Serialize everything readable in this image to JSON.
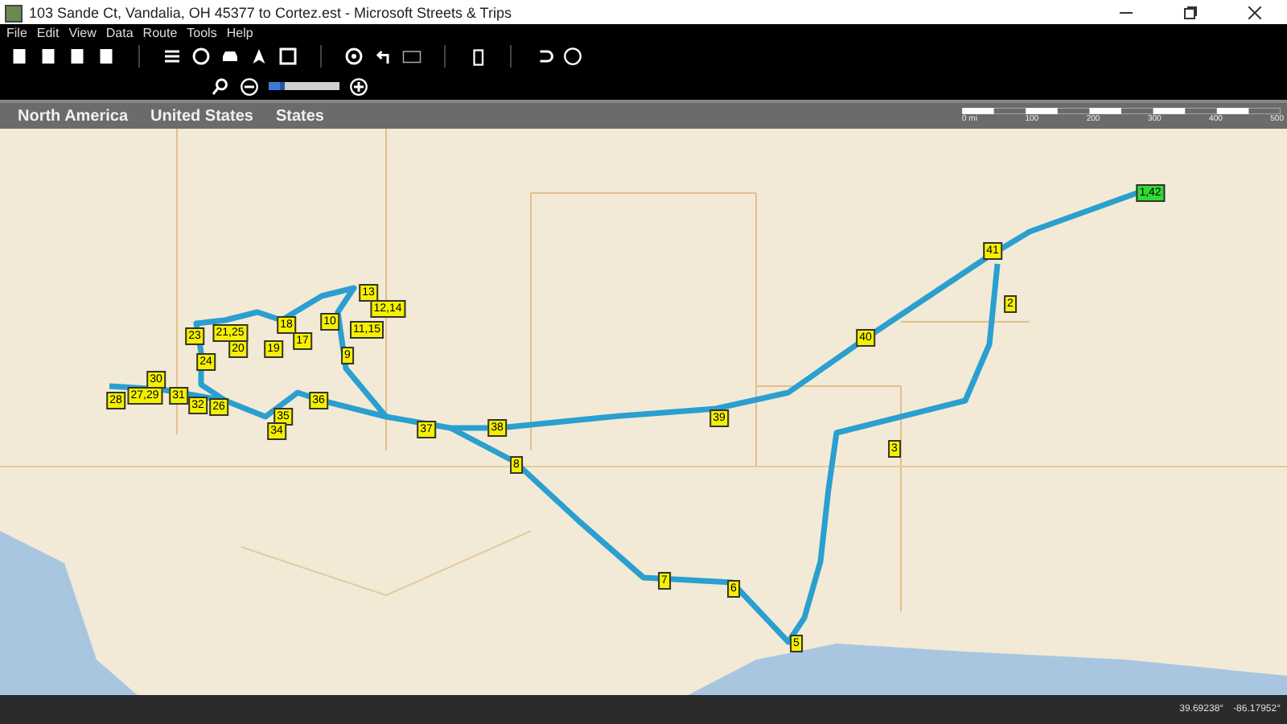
{
  "window": {
    "title": "103 Sande Ct, Vandalia, OH 45377 to Cortez.est - Microsoft Streets & Trips"
  },
  "menu": [
    "File",
    "Edit",
    "View",
    "Data",
    "Route",
    "Tools",
    "Help"
  ],
  "zoom_slider": {
    "level": 0.22
  },
  "breadcrumbs": [
    "North America",
    "United States",
    "States"
  ],
  "scale_bar": [
    "0 mi",
    "100",
    "200",
    "300",
    "400",
    "500"
  ],
  "stops": [
    {
      "label": "1,42",
      "kind": "start"
    },
    {
      "label": "41",
      "kind": "stop"
    },
    {
      "label": "13",
      "kind": "stop"
    },
    {
      "label": "2",
      "kind": "stop"
    },
    {
      "label": "12,14",
      "kind": "stop"
    },
    {
      "label": "23",
      "kind": "stop"
    },
    {
      "label": "21,25",
      "kind": "stop"
    },
    {
      "label": "18",
      "kind": "stop"
    },
    {
      "label": "10",
      "kind": "stop"
    },
    {
      "label": "11,15",
      "kind": "stop"
    },
    {
      "label": "17",
      "kind": "stop"
    },
    {
      "label": "40",
      "kind": "stop"
    },
    {
      "label": "20",
      "kind": "stop"
    },
    {
      "label": "19",
      "kind": "stop"
    },
    {
      "label": "9",
      "kind": "stop"
    },
    {
      "label": "24",
      "kind": "stop"
    },
    {
      "label": "30",
      "kind": "stop"
    },
    {
      "label": "27,29",
      "kind": "stop"
    },
    {
      "label": "31",
      "kind": "stop"
    },
    {
      "label": "28",
      "kind": "stop"
    },
    {
      "label": "32",
      "kind": "stop"
    },
    {
      "label": "36",
      "kind": "stop"
    },
    {
      "label": "26",
      "kind": "stop"
    },
    {
      "label": "35",
      "kind": "stop"
    },
    {
      "label": "39",
      "kind": "stop"
    },
    {
      "label": "34",
      "kind": "stop"
    },
    {
      "label": "37",
      "kind": "stop"
    },
    {
      "label": "38",
      "kind": "stop"
    },
    {
      "label": "3",
      "kind": "stop"
    },
    {
      "label": "8",
      "kind": "stop"
    },
    {
      "label": "7",
      "kind": "stop"
    },
    {
      "label": "6",
      "kind": "stop"
    },
    {
      "label": "5",
      "kind": "stop"
    }
  ],
  "status_bar": {
    "latitude": "39.69238°",
    "longitude": "-86.17952°"
  }
}
